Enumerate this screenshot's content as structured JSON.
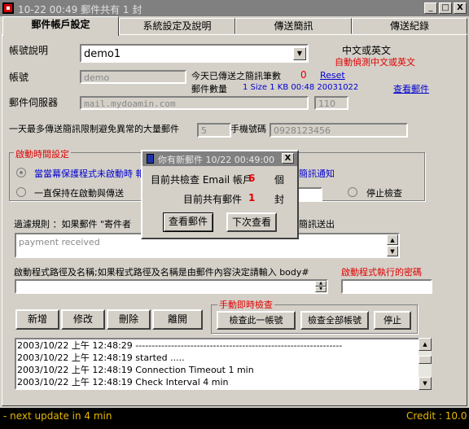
{
  "window": {
    "title": "10-22 00:49 郵件共有 1 封",
    "minimize": "_",
    "maximize": "□",
    "close": "X"
  },
  "tabs": [
    {
      "label": "郵件帳戶設定",
      "active": true
    },
    {
      "label": "系統設定及說明",
      "active": false
    },
    {
      "label": "傳送簡訊",
      "active": false
    },
    {
      "label": "傳送紀錄",
      "active": false
    }
  ],
  "account": {
    "desc_label": "帳號說明",
    "desc_value": "demo1",
    "lang_label": "中文或英文",
    "lang_hint": "自動偵測中文或英文",
    "account_label": "帳號",
    "account_value": "demo",
    "sent_today_label": "今天已傳送之簡訊筆數",
    "sent_today_value": "0",
    "reset_link": "Reset",
    "mail_count_label": "郵件數量",
    "mail_count_value": "1 Size 1 KB 00:48 20031022",
    "view_mail_link": "查看郵件",
    "server_label": "郵件伺服器",
    "server_value": "mail.mydoamin.com",
    "port_value": "110",
    "daily_limit_label": "一天最多傳送簡訊限制避免異常的大量郵件",
    "daily_limit_value": "5",
    "phone_label": "手機號碼",
    "phone_value": "0928123456"
  },
  "startup_group": {
    "title": "啟動時間設定",
    "opt1_partial": "當當幕保護程式未啟動時 報",
    "opt1_right": "簡訊通知",
    "opt2": "一直保持在啟動與傳送",
    "stop_check": "停止檢查"
  },
  "filter": {
    "label_left": "過濾規則 ：如果郵件 \"寄件者",
    "label_right": "簡訊送出",
    "value": "payment received"
  },
  "program": {
    "path_label": "啟動程式路徑及名稱;如果程式路徑及名稱是由郵件內容決定請輸入 body#",
    "password_label": "啟動程式執行的密碼"
  },
  "buttons": {
    "add": "新增",
    "modify": "修改",
    "delete": "刪除",
    "exit": "離開"
  },
  "manual_check": {
    "title": "手動即時檢查",
    "check_this": "檢查此一帳號",
    "check_all": "檢查全部帳號",
    "stop": "停止"
  },
  "log": [
    "2003/10/22 上午 12:48:29 ----------------------------------------------------------------",
    "2003/10/22 上午 12:48:19 started .....",
    "2003/10/22 上午 12:48:19 Connection Timeout 1 min",
    "2003/10/22 上午 12:48:19 Check Interval 4 min"
  ],
  "status": {
    "left": "- next update in 4 min",
    "right": "Credit :   10.0"
  },
  "dialog": {
    "title": "你有新郵件 10/22 00:49:00",
    "line1_label": "目前共檢查 Email 帳戶",
    "line1_value": "6",
    "line1_unit": "個",
    "line2_label": "目前共有郵件",
    "line2_value": "1",
    "line2_unit": "封",
    "view_button": "查看郵件",
    "later_button": "下次查看",
    "close": "X"
  }
}
